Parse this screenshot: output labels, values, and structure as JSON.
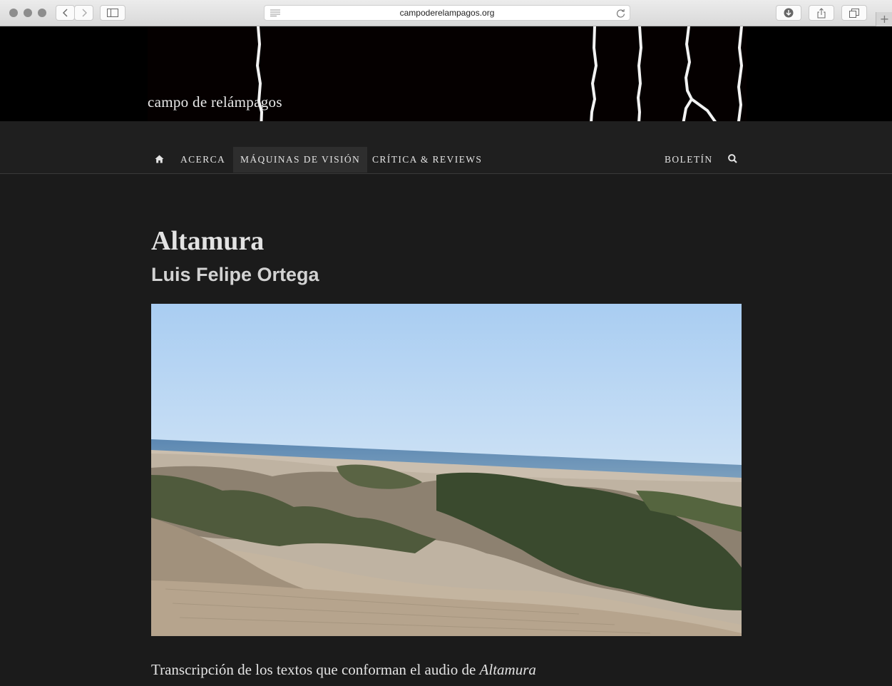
{
  "browser": {
    "url": "campoderelampagos.org"
  },
  "site": {
    "logo": "campo de relámpagos"
  },
  "nav": {
    "home_icon": "home-icon",
    "items": [
      "Acerca",
      "Máquinas de visión",
      "Crítica & Reviews"
    ],
    "right": [
      "Boletín"
    ],
    "search_icon": "search-icon"
  },
  "article": {
    "title": "Altamura",
    "author": "Luis Felipe Ortega",
    "intro_prefix": "Transcripción de los textos que conforman el audio de ",
    "intro_italic": "Altamura"
  },
  "colors": {
    "page_bg": "#1b1b1b",
    "banner_bg": "#000000",
    "nav_active_bg": "#2e2e2e",
    "text": "#e3e3e3"
  }
}
